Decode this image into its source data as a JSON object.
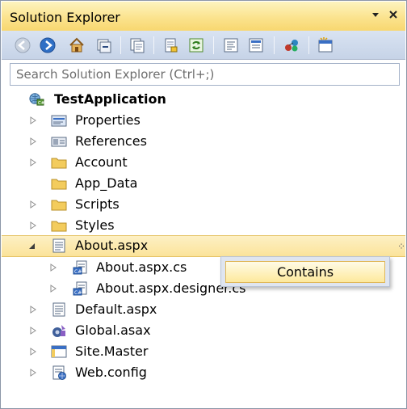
{
  "window": {
    "title": "Solution Explorer",
    "pin_glyph": "▾",
    "close_glyph": "✕"
  },
  "toolbar": {
    "buttons": [
      {
        "name": "back-icon"
      },
      {
        "name": "forward-icon"
      },
      {
        "name": "home-icon"
      },
      {
        "name": "collapse-all-icon"
      },
      {
        "name": "show-all-files-icon"
      },
      {
        "name": "properties-icon"
      },
      {
        "name": "refresh-icon"
      },
      {
        "name": "view-code-icon"
      },
      {
        "name": "view-designer-icon"
      },
      {
        "name": "view-class-diagram-icon"
      },
      {
        "name": "new-view-icon"
      }
    ]
  },
  "search": {
    "placeholder": "Search Solution Explorer (Ctrl+;)",
    "value": ""
  },
  "tree": {
    "root": {
      "label": "TestApplication",
      "icon": "web-project-icon"
    },
    "items": [
      {
        "label": "Properties",
        "icon": "properties-folder-icon",
        "expander": "collapsed"
      },
      {
        "label": "References",
        "icon": "references-icon",
        "expander": "collapsed"
      },
      {
        "label": "Account",
        "icon": "folder-icon",
        "expander": "collapsed"
      },
      {
        "label": "App_Data",
        "icon": "folder-icon",
        "expander": "none"
      },
      {
        "label": "Scripts",
        "icon": "folder-icon",
        "expander": "collapsed"
      },
      {
        "label": "Styles",
        "icon": "folder-icon",
        "expander": "collapsed"
      },
      {
        "label": "About.aspx",
        "icon": "aspx-page-icon",
        "expander": "expanded",
        "selected": true
      },
      {
        "label": "About.aspx.cs",
        "icon": "csharp-file-icon",
        "expander": "collapsed",
        "child": true
      },
      {
        "label": "About.aspx.designer.cs",
        "icon": "csharp-file-icon",
        "expander": "collapsed",
        "child": true
      },
      {
        "label": "Default.aspx",
        "icon": "aspx-page-icon",
        "expander": "collapsed"
      },
      {
        "label": "Global.asax",
        "icon": "global-asax-icon",
        "expander": "collapsed"
      },
      {
        "label": "Site.Master",
        "icon": "master-page-icon",
        "expander": "collapsed"
      },
      {
        "label": "Web.config",
        "icon": "web-config-icon",
        "expander": "collapsed"
      }
    ]
  },
  "context_popup": {
    "label": "Contains"
  },
  "colors": {
    "title_bar": "#fbe38e",
    "toolbar": "#cfdaec",
    "selection": "#fbe39a",
    "selection_border": "#e5c365",
    "folder": "#f3cc5d"
  }
}
